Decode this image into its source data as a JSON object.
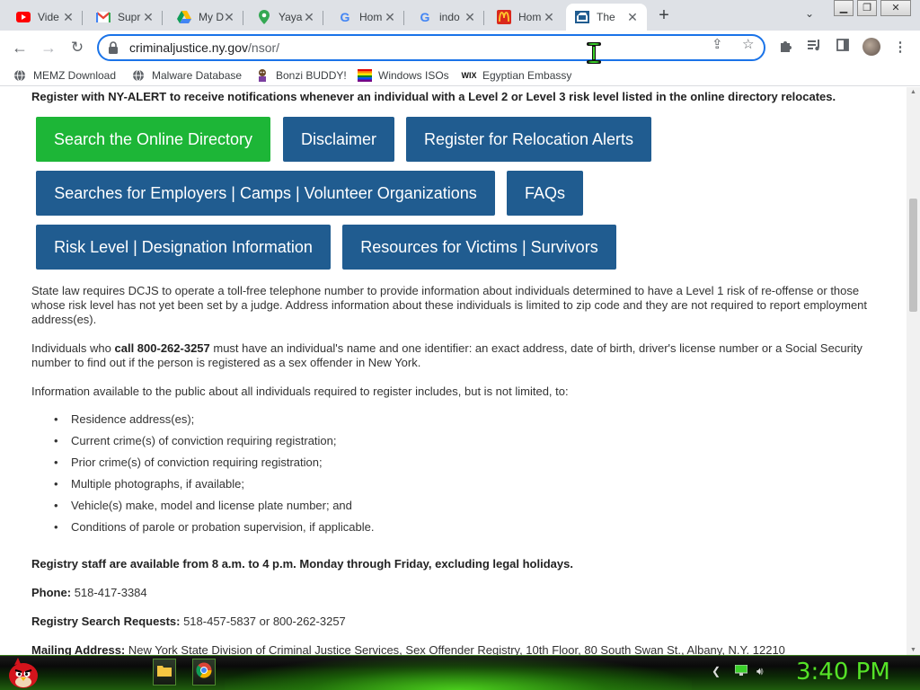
{
  "browser": {
    "tabs": [
      {
        "title": "Vide",
        "icon": "youtube-icon"
      },
      {
        "title": "Supr",
        "icon": "gmail-icon"
      },
      {
        "title": "My D",
        "icon": "google-drive-icon"
      },
      {
        "title": "Yaya",
        "icon": "google-maps-icon"
      },
      {
        "title": "Hom",
        "icon": "google-icon"
      },
      {
        "title": "indo",
        "icon": "google-icon"
      },
      {
        "title": "Hom",
        "icon": "mcdonalds-icon"
      },
      {
        "title": "The",
        "icon": "ny-dcjs-icon",
        "active": true
      }
    ],
    "new_tab": "+",
    "url_host": "criminaljustice.ny.gov",
    "url_path": "/nsor/",
    "bookmarks": [
      {
        "label": "MEMZ Download",
        "icon": "globe-icon"
      },
      {
        "label": "Malware Database",
        "icon": "globe-icon"
      },
      {
        "label": "Bonzi BUDDY!",
        "icon": "bonzi-icon"
      },
      {
        "label": "Windows ISOs",
        "icon": "windows-icon"
      },
      {
        "label": "Egyptian Embassy",
        "icon": "wix-icon"
      }
    ]
  },
  "page": {
    "notice": "Register with NY-ALERT to receive notifications whenever an individual with a Level 2 or Level 3 risk level listed in the online directory relocates.",
    "buttons": {
      "search_directory": "Search the Online Directory",
      "disclaimer": "Disclaimer",
      "relocation_alerts": "Register for Relocation Alerts",
      "employers": "Searches for Employers | Camps | Volunteer Organizations",
      "faqs": "FAQs",
      "risk_level": "Risk Level | Designation Information",
      "victims": "Resources for Victims | Survivors"
    },
    "para1": "State law requires DCJS to operate a toll-free telephone number to provide information about individuals determined to have a Level 1 risk of re-offense or those whose risk level has not yet been set by a judge. Address information about these individuals is limited to zip code and they are not required to report employment address(es).",
    "para2_prefix": "Individuals who ",
    "para2_bold": "call 800-262-3257",
    "para2_suffix": " must have an individual's name and one identifier: an exact address, date of birth, driver's license number or a Social Security number to find out if the person is registered as a sex offender in New York.",
    "para3": "Information available to the public about all individuals required to register includes, but is not limited, to:",
    "list": [
      "Residence address(es);",
      "Current crime(s) of conviction requiring registration;",
      "Prior crime(s) of conviction requiring registration;",
      "Multiple photographs, if available;",
      "Vehicle(s) make, model and license plate number; and",
      "Conditions of parole or probation supervision, if applicable."
    ],
    "hours": "Registry staff are available from 8 a.m. to 4 p.m. Monday through Friday, excluding legal holidays.",
    "phone_label": "Phone:",
    "phone_value": "518-417-3384",
    "search_label": "Registry Search Requests:",
    "search_value": "518-457-5837 or 800-262-3257",
    "mailing_label": "Mailing Address:",
    "mailing_value": "New York State Division of Criminal Justice Services, Sex Offender Registry, 10th Floor, 80 South Swan St., Albany, N.Y. 12210"
  },
  "taskbar": {
    "clock": "3:40 PM"
  },
  "colors": {
    "button_blue": "#205c90",
    "button_green": "#1db637",
    "clock_green": "#55e227",
    "omnibox_focus": "#1a73e8"
  }
}
